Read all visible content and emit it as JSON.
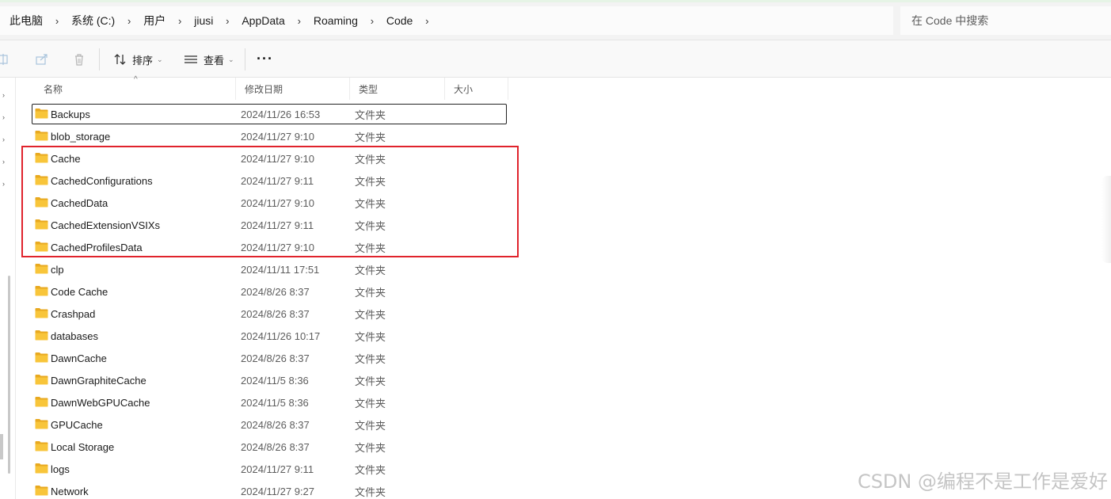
{
  "breadcrumb": {
    "items": [
      "此电脑",
      "系统 (C:)",
      "用户",
      "jiusi",
      "AppData",
      "Roaming",
      "Code"
    ],
    "separator": "›"
  },
  "search": {
    "placeholder": "在 Code 中搜索"
  },
  "toolbar": {
    "sort_label": "排序",
    "view_label": "查看",
    "more_label": "···",
    "icons": [
      "rename-icon",
      "share-icon",
      "delete-icon",
      "sort-icon",
      "view-icon"
    ]
  },
  "columns": {
    "name": "名称",
    "date": "修改日期",
    "type": "类型",
    "size": "大小"
  },
  "files": [
    {
      "name": "Backups",
      "date": "2024/11/26 16:53",
      "type": "文件夹"
    },
    {
      "name": "blob_storage",
      "date": "2024/11/27 9:10",
      "type": "文件夹"
    },
    {
      "name": "Cache",
      "date": "2024/11/27 9:10",
      "type": "文件夹"
    },
    {
      "name": "CachedConfigurations",
      "date": "2024/11/27 9:11",
      "type": "文件夹"
    },
    {
      "name": "CachedData",
      "date": "2024/11/27 9:10",
      "type": "文件夹"
    },
    {
      "name": "CachedExtensionVSIXs",
      "date": "2024/11/27 9:11",
      "type": "文件夹"
    },
    {
      "name": "CachedProfilesData",
      "date": "2024/11/27 9:10",
      "type": "文件夹"
    },
    {
      "name": "clp",
      "date": "2024/11/11 17:51",
      "type": "文件夹"
    },
    {
      "name": "Code Cache",
      "date": "2024/8/26 8:37",
      "type": "文件夹"
    },
    {
      "name": "Crashpad",
      "date": "2024/8/26 8:37",
      "type": "文件夹"
    },
    {
      "name": "databases",
      "date": "2024/11/26 10:17",
      "type": "文件夹"
    },
    {
      "name": "DawnCache",
      "date": "2024/8/26 8:37",
      "type": "文件夹"
    },
    {
      "name": "DawnGraphiteCache",
      "date": "2024/11/5 8:36",
      "type": "文件夹"
    },
    {
      "name": "DawnWebGPUCache",
      "date": "2024/11/5 8:36",
      "type": "文件夹"
    },
    {
      "name": "GPUCache",
      "date": "2024/8/26 8:37",
      "type": "文件夹"
    },
    {
      "name": "Local Storage",
      "date": "2024/8/26 8:37",
      "type": "文件夹"
    },
    {
      "name": "logs",
      "date": "2024/11/27 9:11",
      "type": "文件夹"
    },
    {
      "name": "Network",
      "date": "2024/11/27 9:27",
      "type": "文件夹"
    }
  ],
  "colors": {
    "folder_yellow": "#f8c53a",
    "folder_yellow_dark": "#e8a920",
    "annotation_red": "#e0232c"
  },
  "watermark": "CSDN @编程不是工作是爱好"
}
